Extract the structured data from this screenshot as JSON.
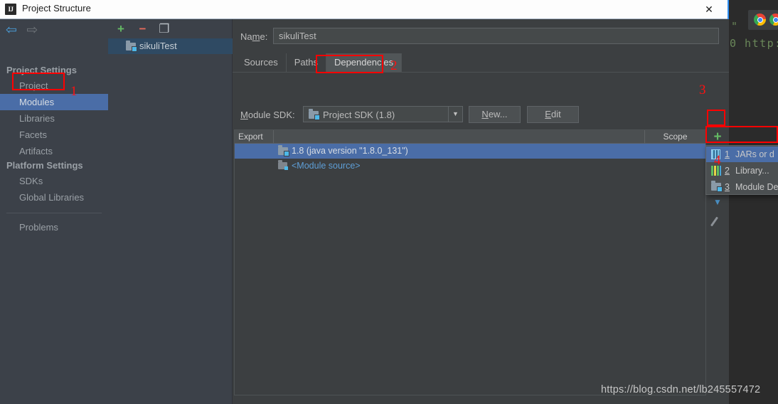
{
  "dialog": {
    "title": "Project Structure",
    "logo_text": "IJ",
    "close_label": "✕"
  },
  "background": {
    "code_quote": "\"",
    "code_line": "0 http:"
  },
  "nav": {
    "back": "⇦",
    "forward": "⇨"
  },
  "sidebar": {
    "groups": [
      {
        "label": "Project Settings"
      },
      {
        "label": "Platform Settings"
      }
    ],
    "items": [
      {
        "label": "Project",
        "selected": false
      },
      {
        "label": "Modules",
        "selected": true
      },
      {
        "label": "Libraries",
        "selected": false
      },
      {
        "label": "Facets",
        "selected": false
      },
      {
        "label": "Artifacts",
        "selected": false
      },
      {
        "label": "SDKs",
        "selected": false
      },
      {
        "label": "Global Libraries",
        "selected": false
      },
      {
        "label": "Problems",
        "selected": false
      }
    ]
  },
  "modules_panel": {
    "toolbar": {
      "add": "+",
      "remove": "−",
      "copy": "❐"
    },
    "selected_module": "sikuliTest"
  },
  "content": {
    "name_label": "Name:",
    "name_value": "sikuliTest",
    "tabs": [
      {
        "label": "Sources",
        "active": false
      },
      {
        "label": "Paths",
        "active": false
      },
      {
        "label": "Dependencies",
        "active": true
      }
    ],
    "sdk_label": "Module SDK:",
    "sdk_value": "Project SDK (1.8)",
    "sdk_arrow": "▼",
    "btn_new": "New...",
    "btn_edit": "Edit"
  },
  "dependencies_table": {
    "columns": {
      "export": "Export",
      "scope": "Scope"
    },
    "rows": [
      {
        "label": "1.8 (java version \"1.8.0_131\")",
        "selected": true,
        "color": "#d8dde3"
      },
      {
        "label": "<Module source>",
        "selected": false,
        "color": "#5e9ed6"
      }
    ]
  },
  "dep_toolbar": {
    "add": "+",
    "move_down": "▼",
    "edit": "pencil"
  },
  "add_menu": {
    "items": [
      {
        "num": "1",
        "text": "JARs or d",
        "icon": "jar-icon",
        "highlight": true
      },
      {
        "num": "2",
        "text": "Library...",
        "icon": "library-icon",
        "highlight": false
      },
      {
        "num": "3",
        "text": "Module De",
        "icon": "module-dep-icon",
        "highlight": false
      }
    ]
  },
  "annotations": [
    {
      "num": "1"
    },
    {
      "num": "2"
    },
    {
      "num": "3"
    },
    {
      "num": "4"
    }
  ],
  "watermark": "https://blog.csdn.net/lb245557472",
  "colors": {
    "accent_blue": "#4a6da7",
    "annotation_red": "#ff0000",
    "add_green": "#64b964",
    "dialog_bg": "#3c3f41",
    "sidebar_bg": "#3c4149"
  }
}
